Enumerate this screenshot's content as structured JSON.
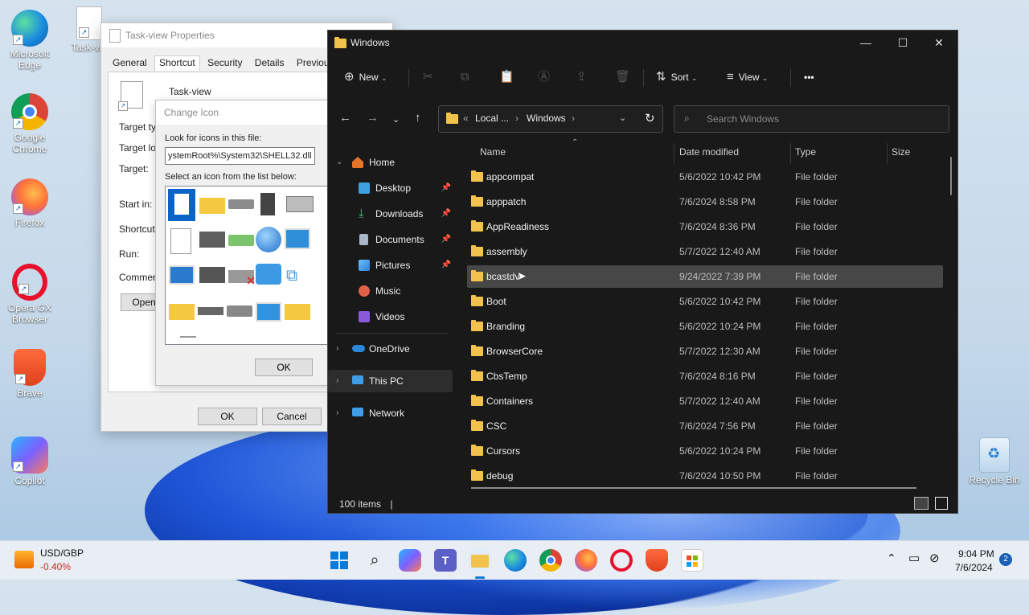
{
  "desktop": {
    "icons": [
      {
        "label": "Microsoft Edge",
        "icon": "edge-icon",
        "color": "#1b8de0"
      },
      {
        "label": "Google Chrome",
        "icon": "chrome-icon",
        "color": "#db4437"
      },
      {
        "label": "Firefox",
        "icon": "firefox-icon",
        "color": "#ff7139"
      },
      {
        "label": "Opera GX Browser",
        "icon": "opera-icon",
        "color": "#e8112d"
      },
      {
        "label": "Brave",
        "icon": "brave-icon",
        "color": "#fb542b"
      },
      {
        "label": "Copilot",
        "icon": "copilot-icon",
        "color": "#7b61ff"
      },
      {
        "label": "Task-vie",
        "icon": "shortcut-file-icon",
        "color": "#ffffff"
      },
      {
        "label": "Recycle Bin",
        "icon": "recycle-bin-icon",
        "color": "#2d7fd3"
      }
    ]
  },
  "properties": {
    "title": "Task-view Properties",
    "tabs": [
      "General",
      "Shortcut",
      "Security",
      "Details",
      "Previous Versio"
    ],
    "active_tab": "Shortcut",
    "shortcut_name": "Task-view",
    "labels": [
      "Target typ",
      "Target loc",
      "Target:",
      "Start in:",
      "Shortcut k",
      "Run:",
      "Comment:"
    ],
    "open_button": "Open",
    "ok": "OK",
    "cancel": "Cancel"
  },
  "change_icon": {
    "title": "Change Icon",
    "look_label": "Look for icons in this file:",
    "path_value": "ystemRoot%\\System32\\SHELL32.dll",
    "select_label": "Select an icon from the list below:",
    "ok": "OK"
  },
  "explorer": {
    "title": "Windows",
    "toolbar": {
      "new": "New",
      "sort": "Sort",
      "view": "View",
      "more": "•••"
    },
    "breadcrumb": {
      "sep": "«",
      "parent": "Local ...",
      "current": "Windows"
    },
    "search_placeholder": "Search Windows",
    "nav": {
      "home": "Home",
      "desktop": "Desktop",
      "downloads": "Downloads",
      "documents": "Documents",
      "pictures": "Pictures",
      "music": "Music",
      "videos": "Videos",
      "onedrive": "OneDrive",
      "thispc": "This PC",
      "network": "Network"
    },
    "columns": {
      "name": "Name",
      "date": "Date modified",
      "type": "Type",
      "size": "Size"
    },
    "files": [
      {
        "name": "appcompat",
        "date": "5/6/2022 10:42 PM",
        "type": "File folder"
      },
      {
        "name": "apppatch",
        "date": "7/6/2024 8:58 PM",
        "type": "File folder"
      },
      {
        "name": "AppReadiness",
        "date": "7/6/2024 8:36 PM",
        "type": "File folder"
      },
      {
        "name": "assembly",
        "date": "5/7/2022 12:40 AM",
        "type": "File folder"
      },
      {
        "name": "bcastdv",
        "date": "9/24/2022 7:39 PM",
        "type": "File folder",
        "selected": true
      },
      {
        "name": "Boot",
        "date": "5/6/2022 10:42 PM",
        "type": "File folder"
      },
      {
        "name": "Branding",
        "date": "5/6/2022 10:24 PM",
        "type": "File folder"
      },
      {
        "name": "BrowserCore",
        "date": "5/7/2022 12:30 AM",
        "type": "File folder"
      },
      {
        "name": "CbsTemp",
        "date": "7/6/2024 8:16 PM",
        "type": "File folder"
      },
      {
        "name": "Containers",
        "date": "5/7/2022 12:40 AM",
        "type": "File folder"
      },
      {
        "name": "CSC",
        "date": "7/6/2024 7:56 PM",
        "type": "File folder"
      },
      {
        "name": "Cursors",
        "date": "5/6/2022 10:24 PM",
        "type": "File folder"
      },
      {
        "name": "debug",
        "date": "7/6/2024 10:50 PM",
        "type": "File folder"
      }
    ],
    "status": "100 items"
  },
  "taskbar": {
    "widget_title": "USD/GBP",
    "widget_value": "-0.40%",
    "widget_value_color": "#c42b1c",
    "time": "9:04 PM",
    "date": "7/6/2024",
    "notifications": "2"
  }
}
